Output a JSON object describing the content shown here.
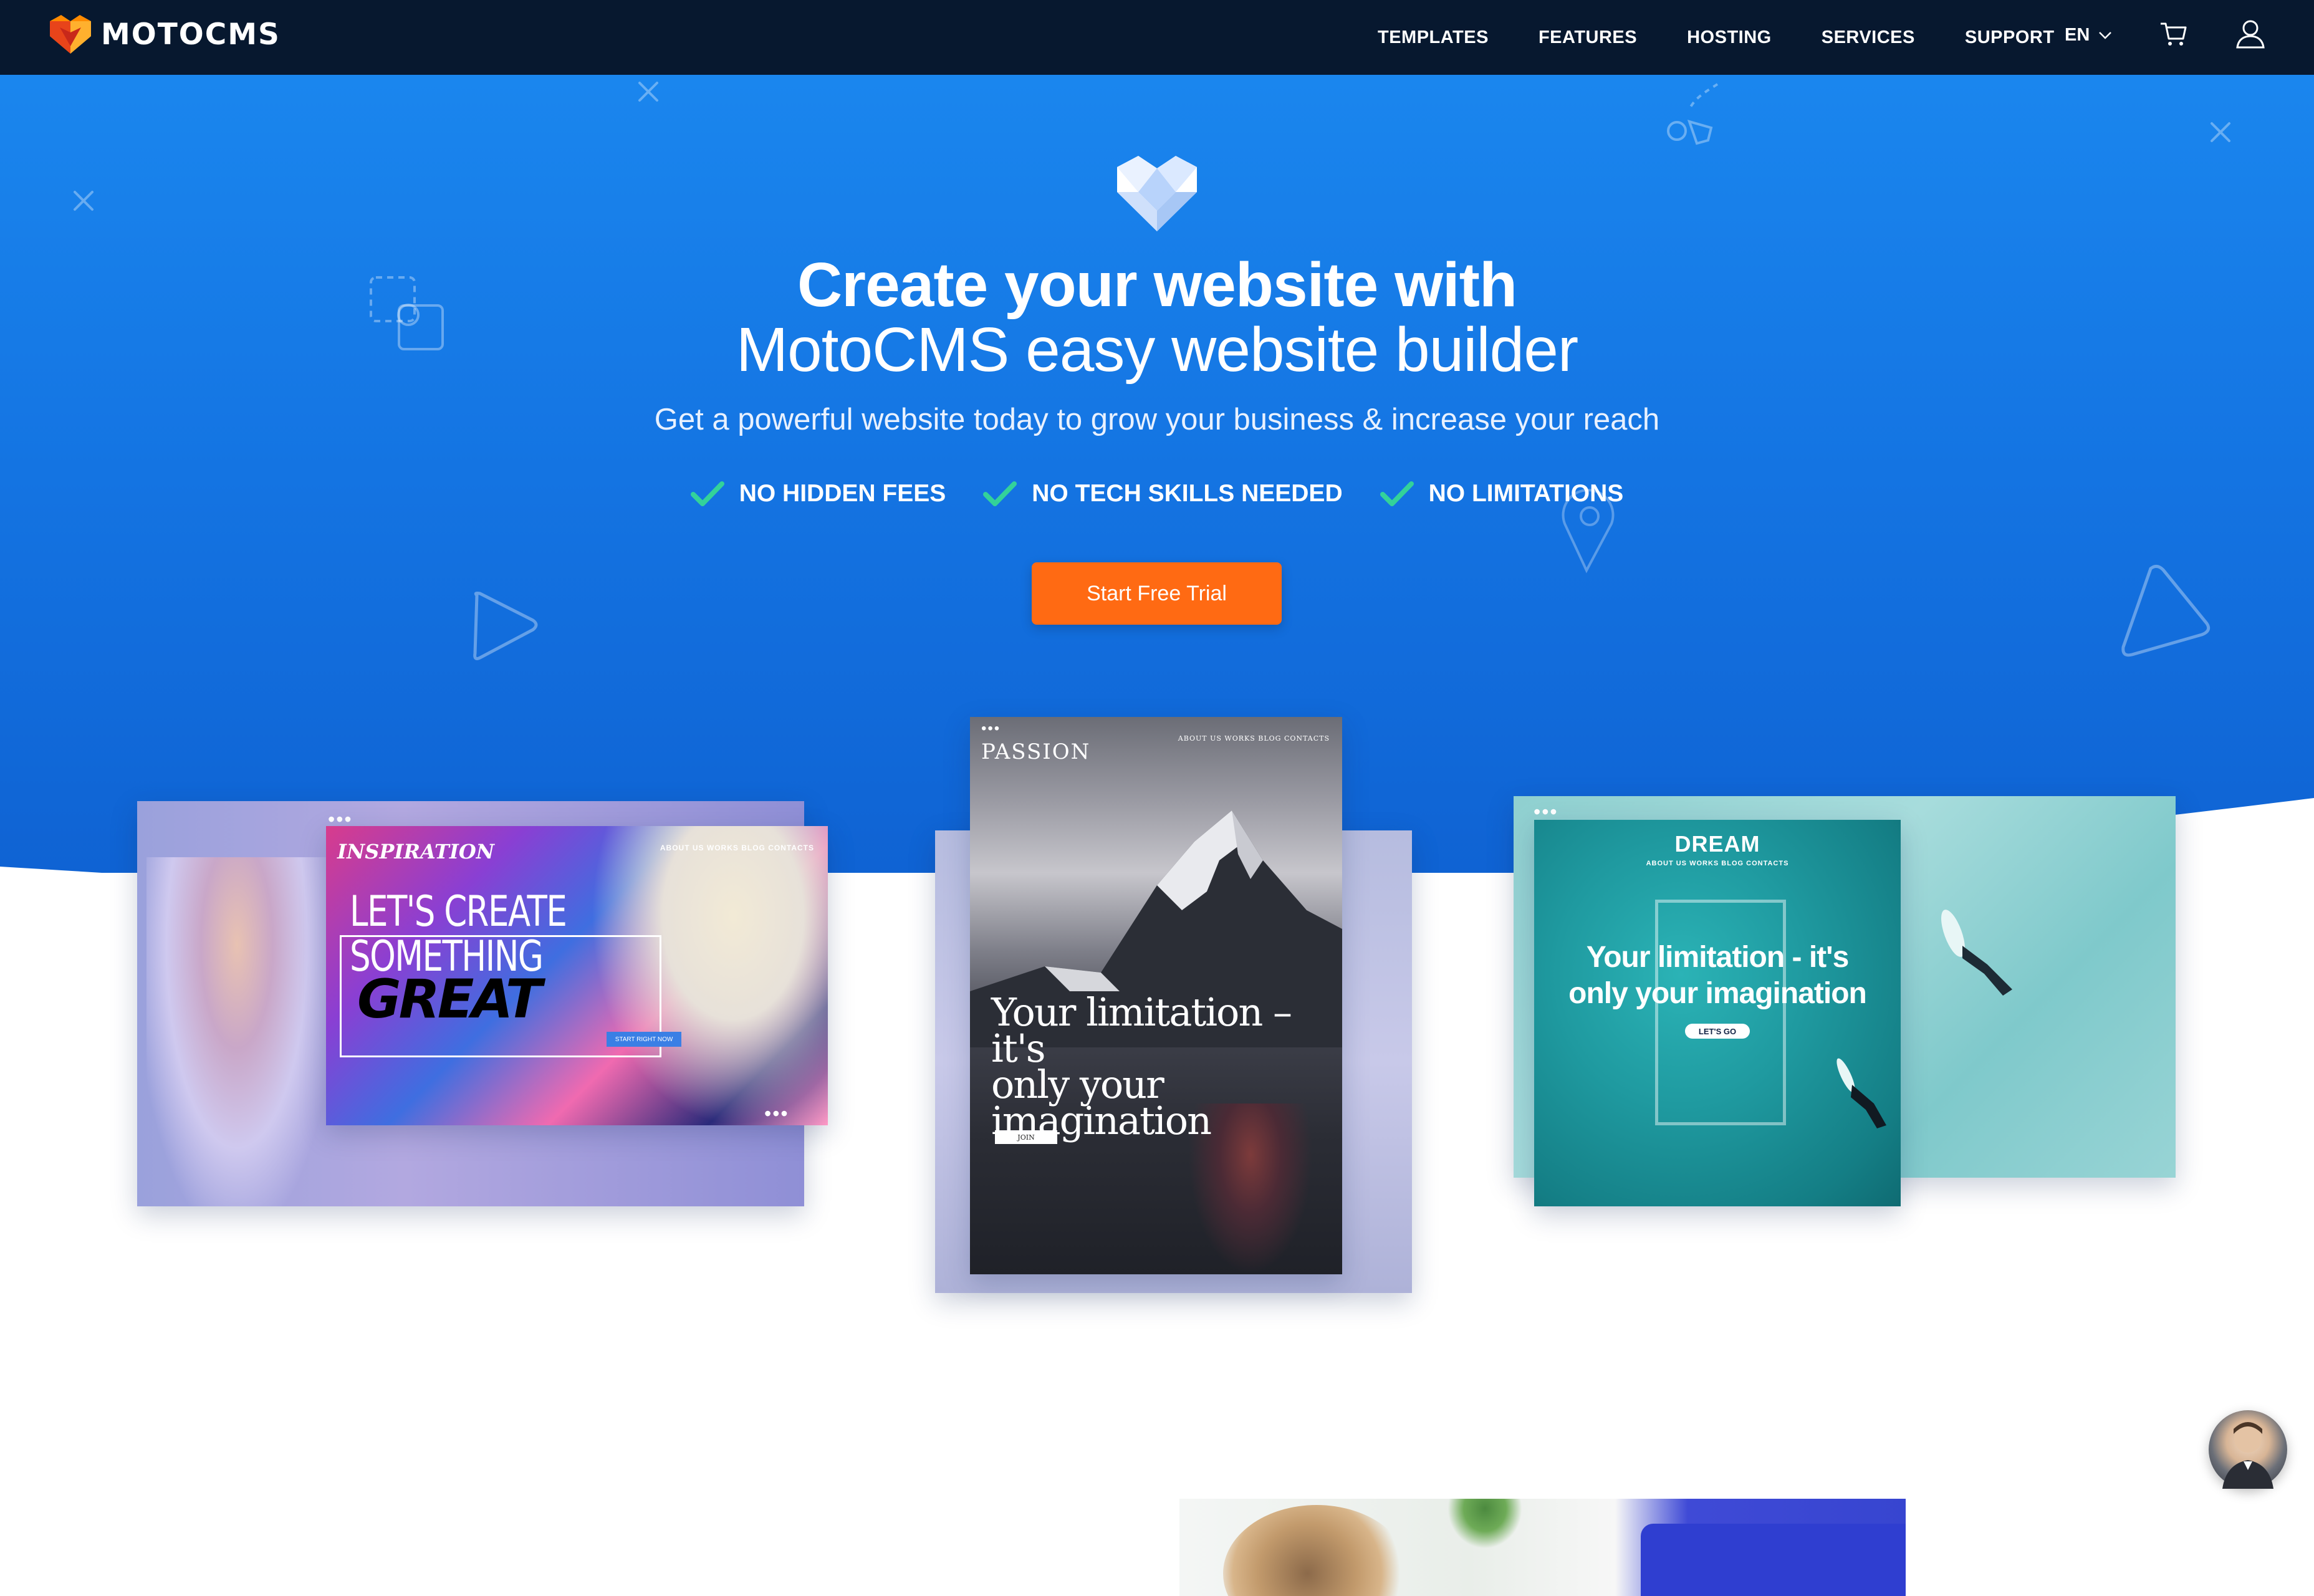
{
  "nav": {
    "brand": "MOTOCMS",
    "menu": [
      "TEMPLATES",
      "FEATURES",
      "HOSTING",
      "SERVICES",
      "SUPPORT"
    ],
    "language": "EN",
    "cart_icon": "cart-icon",
    "user_icon": "user-icon"
  },
  "hero": {
    "title_line1": "Create your website with",
    "title_line2": "MotoCMS easy website builder",
    "subtitle": "Get a powerful website today to grow your business & increase your reach",
    "features": [
      "NO HIDDEN FEES",
      "NO TECH SKILLS NEEDED",
      "NO LIMITATIONS"
    ],
    "cta": "Start Free Trial"
  },
  "templates": {
    "inspiration": {
      "brand": "INSPIRATION",
      "nav": "ABOUT US   WORKS   BLOG   CONTACTS",
      "headline_line1": "LET'S CREATE",
      "headline_line2": "SOMETHING",
      "headline_line3": "GREAT",
      "button": "START RIGHT NOW"
    },
    "passion": {
      "brand": "PASSION",
      "nav": "ABOUT US   WORKS   BLOG   CONTACTS",
      "text_line1": "Your limitation – it's",
      "text_line2": "only your",
      "text_line3": "imagination",
      "button": "JOIN"
    },
    "dream": {
      "brand": "DREAM",
      "nav": "ABOUT US    WORKS    BLOG    CONTACTS",
      "text_line1": "Your limitation - it's",
      "text_line2": "only your imagination",
      "button": "LET'S GO"
    }
  },
  "colors": {
    "nav_bg": "#07182f",
    "hero_blue": "#1a86ee",
    "cta_orange": "#ff6a13",
    "check_green": "#33d29a",
    "logo_orange": "#ff8a00",
    "logo_red": "#e8441a"
  }
}
